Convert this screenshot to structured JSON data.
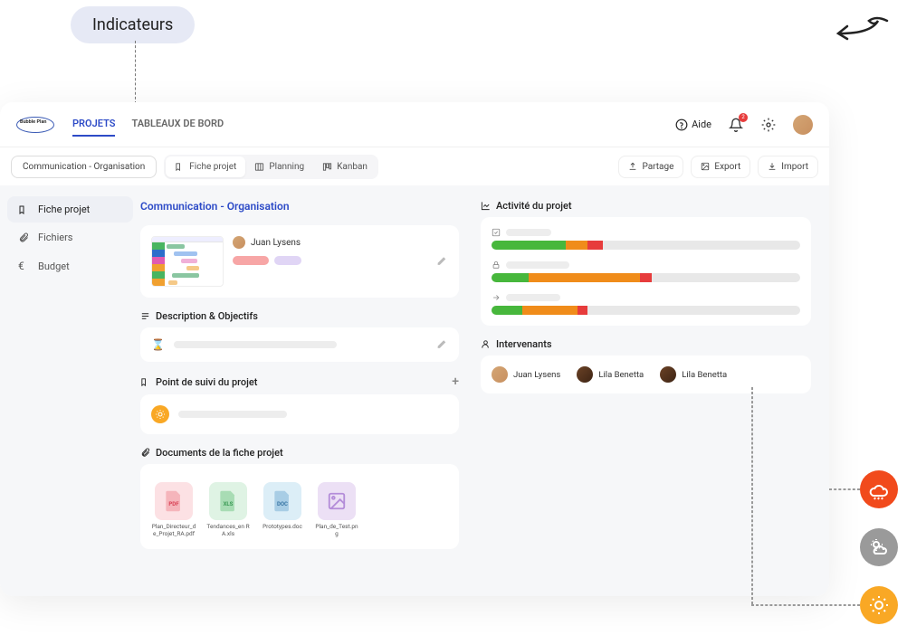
{
  "annotation": {
    "label": "Indicateurs"
  },
  "header": {
    "logo_text": "Bubble Plan",
    "tabs": [
      {
        "label": "PROJETS",
        "active": true
      },
      {
        "label": "TABLEAUX DE BORD",
        "active": false
      }
    ],
    "help_label": "Aide",
    "notif_count": "2"
  },
  "toolbar": {
    "breadcrumb": "Communication - Organisation",
    "view_tabs": [
      {
        "label": "Fiche projet",
        "icon": "flag",
        "active": true
      },
      {
        "label": "Planning",
        "icon": "columns",
        "active": false
      },
      {
        "label": "Kanban",
        "icon": "board",
        "active": false
      }
    ],
    "actions": [
      {
        "label": "Partage",
        "icon": "upload"
      },
      {
        "label": "Export",
        "icon": "image"
      },
      {
        "label": "Import",
        "icon": "download"
      }
    ]
  },
  "sidenav": {
    "items": [
      {
        "label": "Fiche projet",
        "icon": "flag",
        "active": true
      },
      {
        "label": "Fichiers",
        "icon": "paperclip",
        "active": false
      },
      {
        "label": "Budget",
        "icon": "euro",
        "active": false
      }
    ]
  },
  "project": {
    "title": "Communication - Organisation",
    "owner": "Juan Lysens"
  },
  "sections": {
    "description": "Description & Objectifs",
    "suivi": "Point de suivi du projet",
    "documents": "Documents de la fiche projet",
    "activity": "Activité du projet",
    "intervenants": "Intervenants"
  },
  "documents": [
    {
      "name": "Plan_Directeur_de_Projet_RA.pdf",
      "type": "pdf",
      "badge": "PDF"
    },
    {
      "name": "Tendances_en RA.xls",
      "type": "xls",
      "badge": "XLS"
    },
    {
      "name": "Prototypes.doc",
      "type": "doc",
      "badge": "DOC"
    },
    {
      "name": "Plan_de_Test.png",
      "type": "png",
      "badge": ""
    }
  ],
  "chart_data": {
    "type": "bar",
    "title": "Activité du projet",
    "series": [
      {
        "name": "checklist",
        "icon": "check",
        "segments": [
          {
            "color": "green",
            "pct": 24
          },
          {
            "color": "orange",
            "pct": 7
          },
          {
            "color": "red",
            "pct": 5
          }
        ],
        "total": 100
      },
      {
        "name": "lock",
        "icon": "lock",
        "segments": [
          {
            "color": "green",
            "pct": 12
          },
          {
            "color": "orange",
            "pct": 36
          },
          {
            "color": "red",
            "pct": 4
          }
        ],
        "total": 100
      },
      {
        "name": "arrow",
        "icon": "arrow",
        "segments": [
          {
            "color": "green",
            "pct": 10
          },
          {
            "color": "orange",
            "pct": 18
          },
          {
            "color": "red",
            "pct": 3
          }
        ],
        "total": 100
      }
    ]
  },
  "intervenants": [
    {
      "name": "Juan Lysens",
      "avatar": "a1"
    },
    {
      "name": "Lila Benetta",
      "avatar": "a2"
    },
    {
      "name": "Lila Benetta",
      "avatar": "a3"
    }
  ]
}
